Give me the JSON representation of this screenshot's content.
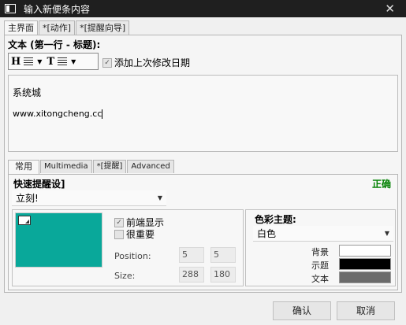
{
  "window": {
    "title": "输入新便条内容",
    "close_glyph": "✕"
  },
  "main_tabs": [
    {
      "label": "主界面"
    },
    {
      "label": "*[动作]"
    },
    {
      "label": "*[提醒向导]"
    }
  ],
  "text_section": {
    "label": "文本 (第一行 - 标题):"
  },
  "format": {
    "heading_glyph": "H",
    "text_glyph": "T"
  },
  "add_date": {
    "label": "添加上次修改日期",
    "checked": true
  },
  "editor": {
    "line1": "系统城",
    "line2": "www.xitongcheng.cc"
  },
  "sub_tabs": [
    {
      "label": "常用"
    },
    {
      "label": "Multimedia"
    },
    {
      "label": "*[提醒]"
    },
    {
      "label": "Advanced"
    }
  ],
  "quick": {
    "label": "快速提醒设]",
    "value": "立刻!",
    "status": "正确",
    "status_color": "#008000"
  },
  "options": {
    "front": {
      "label": "前端显示",
      "checked": true
    },
    "important": {
      "label": "很重要",
      "checked": false
    }
  },
  "position": {
    "label": "Position:",
    "x": "5",
    "y": "5"
  },
  "size": {
    "label": "Size:",
    "w": "288",
    "h": "180"
  },
  "color_theme": {
    "label": "色彩主题:",
    "value": "白色",
    "background_label": "背景",
    "title_label": "示题",
    "text_label": "文本",
    "background_color": "#ffffff",
    "title_color": "#000000",
    "text_color": "#6b6b6b",
    "preview_color": "#09a89a"
  },
  "buttons": {
    "ok": "确认",
    "cancel": "取消"
  }
}
